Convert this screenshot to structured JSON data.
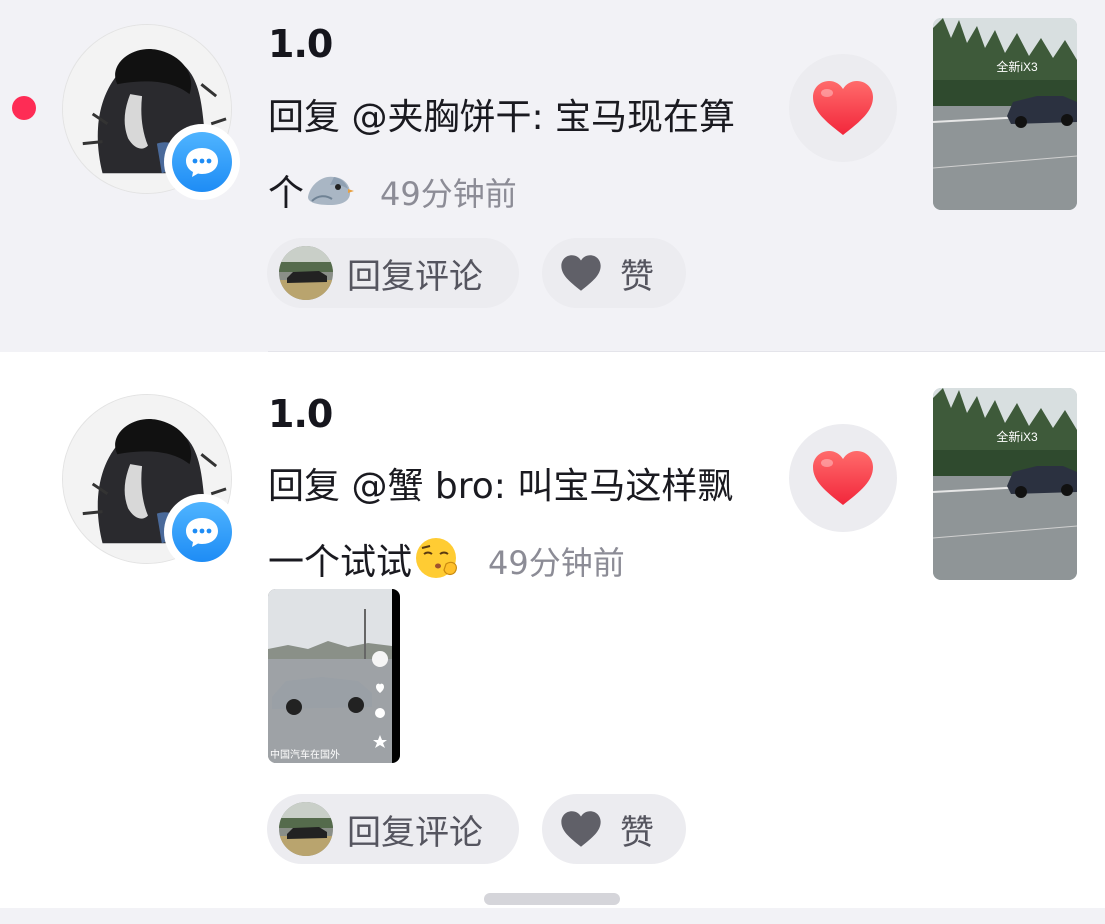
{
  "notifications": [
    {
      "username": "1.0",
      "unread": true,
      "comment_text": "回复 @夹胸饼干: 宝马现在算个",
      "emoji": "pigeon-emoji",
      "time": "49分钟前",
      "video_caption": "全新iX3",
      "reply_label": "回复评论",
      "like_label": "赞"
    },
    {
      "username": "1.0",
      "unread": false,
      "comment_text": "回复 @蟹 bro: 叫宝马这样飘一个试试",
      "emoji": "kissing-closed-eyes-emoji",
      "time": "49分钟前",
      "video_caption": "全新iX3",
      "image_caption": "中国汽车在国外",
      "reply_label": "回复评论",
      "like_label": "赞"
    }
  ],
  "colors": {
    "unread_dot": "#fe2c55",
    "heart": "#ff3b4e",
    "badge_blue": "#1e8cf5",
    "highlight_bg": "#f2f2f6"
  }
}
